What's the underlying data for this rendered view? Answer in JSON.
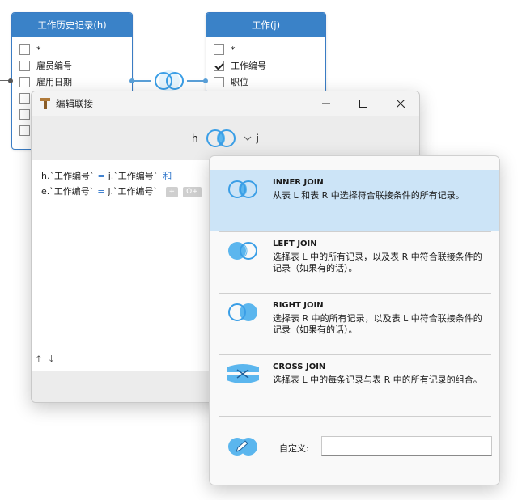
{
  "table_h": {
    "title": "工作历史记录(h)",
    "fields": [
      {
        "label": "*",
        "checked": false
      },
      {
        "label": "雇员编号",
        "checked": false
      },
      {
        "label": "雇用日期",
        "checked": false
      },
      {
        "label": "",
        "checked": false
      },
      {
        "label": "",
        "checked": false
      },
      {
        "label": "",
        "checked": false
      }
    ]
  },
  "table_j": {
    "title": "工作(j)",
    "fields": [
      {
        "label": "*",
        "checked": false
      },
      {
        "label": "工作编号",
        "checked": true
      },
      {
        "label": "职位",
        "checked": false
      }
    ]
  },
  "window": {
    "title": "编辑联接",
    "left_alias": "h",
    "right_alias": "j",
    "conditions": [
      {
        "left": "h.`工作编号`",
        "op": "=",
        "right": "j.`工作编号`",
        "connector": "和"
      },
      {
        "left": "e.`工作编号`",
        "op": "=",
        "right": "j.`工作编号`",
        "connector": ""
      }
    ],
    "add_button": "+",
    "add_group_button": "O+"
  },
  "join_options": [
    {
      "type": "inner",
      "title": "INNER JOIN",
      "desc": "从表 L 和表 R 中选择符合联接条件的所有记录。",
      "selected": true
    },
    {
      "type": "left",
      "title": "LEFT JOIN",
      "desc": "选择表 L 中的所有记录，以及表 R 中符合联接条件的记录（如果有的话）。",
      "selected": false
    },
    {
      "type": "right",
      "title": "RIGHT JOIN",
      "desc": "选择表 R 中的所有记录，以及表 L 中符合联接条件的记录（如果有的话）。",
      "selected": false
    },
    {
      "type": "cross",
      "title": "CROSS JOIN",
      "desc": "选择表 L 中的每条记录与表 R 中的所有记录的组合。",
      "selected": false
    }
  ],
  "custom": {
    "label": "自定义:",
    "value": ""
  },
  "colors": {
    "accent": "#3a82c8",
    "venn_fill": "#5bb6ee",
    "selected_bg": "#cce4f7"
  }
}
